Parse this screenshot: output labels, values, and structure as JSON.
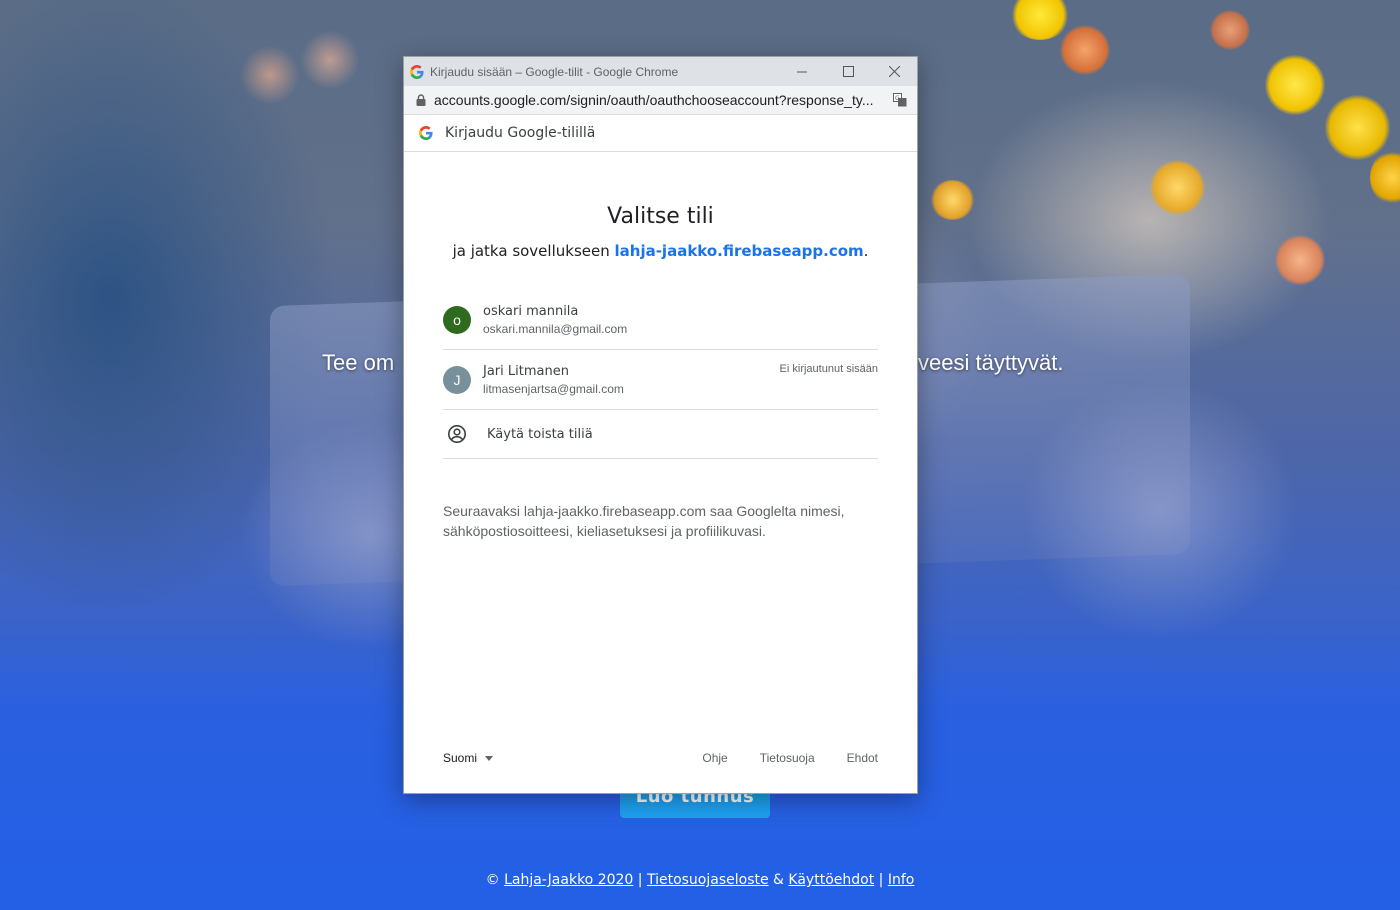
{
  "background": {
    "hero_text_left": "Tee om",
    "hero_text_right": "veesi täyttyvät.",
    "cta_label": "Luo tunnus",
    "footer": {
      "copyright": "© ",
      "brand_link": "Lahja-Jaakko 2020",
      "sep1": " | ",
      "privacy_link": "Tietosuojaseloste",
      "amp": " & ",
      "terms_link": "Käyttöehdot",
      "sep2": " | ",
      "info_link": "Info"
    }
  },
  "window": {
    "title": "Kirjaudu sisään – Google-tilit - Google Chrome",
    "url": "accounts.google.com/signin/oauth/oauthchooseaccount?response_ty...",
    "signin_bar": "Kirjaudu Google-tilillä",
    "heading": "Valitse tili",
    "subheading_prefix": "ja jatka sovellukseen ",
    "app_link": "lahja-jaakko.firebaseapp.com",
    "subheading_suffix": ".",
    "accounts": [
      {
        "initial": "o",
        "name": "oskari mannila",
        "email": "oskari.mannila@gmail.com",
        "status": "",
        "avatar_color": "#2e6b1f"
      },
      {
        "initial": "J",
        "name": "Jari Litmanen",
        "email": "litmasenjartsa@gmail.com",
        "status": "Ei kirjautunut sisään",
        "avatar_color": "#78909c"
      }
    ],
    "other_account": "Käytä toista tiliä",
    "info_text": "Seuraavaksi lahja-jaakko.firebaseapp.com saa Googlelta nimesi, sähköpostiosoitteesi, kieliasetuksesi ja profiilikuvasi.",
    "language": "Suomi",
    "links": {
      "help": "Ohje",
      "privacy": "Tietosuoja",
      "terms": "Ehdot"
    }
  }
}
